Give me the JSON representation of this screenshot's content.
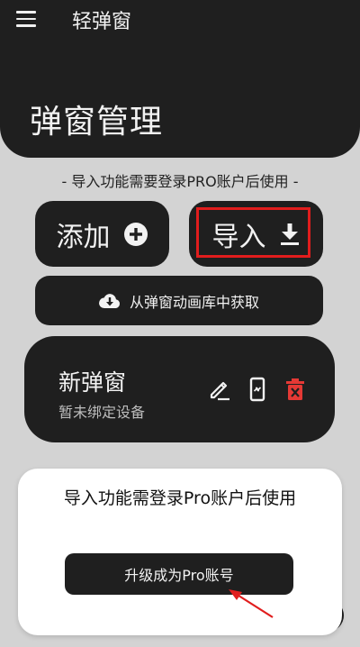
{
  "app_bar": {
    "title": "轻弹窗",
    "menu_icon": "menu-icon"
  },
  "page": {
    "title": "弹窗管理"
  },
  "hint": "- 导入功能需要登录PRO账户后使用 -",
  "actions": {
    "add_label": "添加",
    "add_icon": "plus-circle-icon",
    "import_label": "导入",
    "import_icon": "download-icon",
    "gallery_label": "从弹窗动画库中获取",
    "gallery_icon": "cloud-download-icon"
  },
  "popup_card": {
    "name": "新弹窗",
    "status": "暂未绑定设备",
    "icons": [
      "edit-icon",
      "phone-link-icon",
      "delete-icon"
    ]
  },
  "dialog": {
    "message": "导入功能需登录Pro账户后使用",
    "upgrade_label": "升级成为Pro账号"
  },
  "colors": {
    "background": "#d3d3d3",
    "surface_dark": "#1f1f1f",
    "text_light": "#f2f2f2",
    "danger": "#e53935",
    "annotation": "#e11d1d"
  }
}
